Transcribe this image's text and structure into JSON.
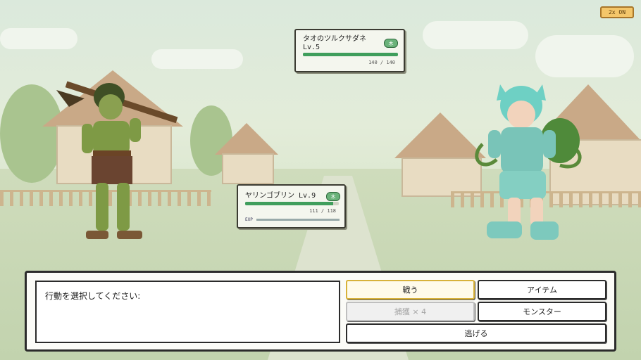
{
  "speed_toggle": "2x ON",
  "enemy": {
    "name": "タオのツルクサダネ",
    "level": "Lv.5",
    "element_icon": "木",
    "hp_text": "140 / 140",
    "hp_fraction": 1.0,
    "hp_color": "#3f9e5c"
  },
  "player": {
    "name_level": "ヤリンゴブリン Lv.9",
    "element_icon": "木",
    "hp_text": "111 / 118",
    "hp_fraction": 0.94,
    "exp_label": "EXP",
    "exp_fraction": 0.0,
    "hp_color": "#3f9e5c"
  },
  "message": "行動を選択してください:",
  "commands": {
    "fight": "戦う",
    "item": "アイテム",
    "capture": "捕獲 × 4",
    "monster": "モンスター",
    "run": "逃げる"
  },
  "colors": {
    "panel_border": "#2b2b2b",
    "selected_border": "#d8b23a",
    "speed_bg": "#f4c66a"
  }
}
